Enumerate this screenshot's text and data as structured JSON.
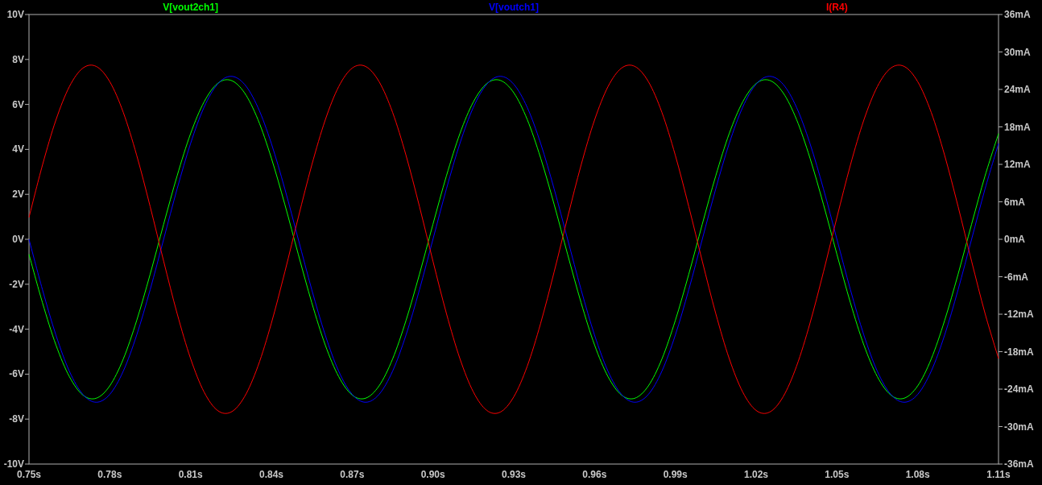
{
  "chart_data": {
    "type": "line",
    "x": [
      0.75,
      0.755,
      0.76,
      0.765,
      0.77,
      0.775,
      0.78,
      0.785,
      0.79,
      0.795,
      0.8,
      0.805,
      0.81,
      0.815,
      0.82,
      0.825,
      0.83,
      0.835,
      0.84,
      0.845,
      0.85,
      0.855,
      0.86,
      0.865,
      0.87,
      0.875,
      0.88,
      0.885,
      0.89,
      0.895,
      0.9,
      0.905,
      0.91,
      0.915,
      0.92,
      0.925,
      0.93,
      0.935,
      0.94,
      0.945,
      0.95,
      0.955,
      0.96,
      0.965,
      0.97,
      0.975,
      0.98,
      0.985,
      0.99,
      0.995,
      1.0,
      1.005,
      1.01,
      1.015,
      1.02,
      1.025,
      1.03,
      1.035,
      1.04,
      1.045,
      1.05,
      1.055,
      1.06,
      1.065,
      1.07,
      1.075,
      1.08,
      1.085,
      1.09,
      1.095,
      1.1,
      1.105,
      1.11
    ],
    "xlim": [
      0.75,
      1.11
    ],
    "ylim": [
      -10,
      10
    ],
    "xticks": [
      {
        "value": 0.75,
        "label": "0.75s"
      },
      {
        "value": 0.78,
        "label": "0.78s"
      },
      {
        "value": 0.81,
        "label": "0.81s"
      },
      {
        "value": 0.84,
        "label": "0.84s"
      },
      {
        "value": 0.87,
        "label": "0.87s"
      },
      {
        "value": 0.9,
        "label": "0.90s"
      },
      {
        "value": 0.93,
        "label": "0.93s"
      },
      {
        "value": 0.96,
        "label": "0.96s"
      },
      {
        "value": 0.99,
        "label": "0.99s"
      },
      {
        "value": 1.02,
        "label": "1.02s"
      },
      {
        "value": 1.05,
        "label": "1.05s"
      },
      {
        "value": 1.08,
        "label": "1.08s"
      },
      {
        "value": 1.11,
        "label": "1.11s"
      }
    ],
    "yticks": [
      {
        "value": 10,
        "label": "10V"
      },
      {
        "value": 8,
        "label": "8V"
      },
      {
        "value": 6,
        "label": "6V"
      },
      {
        "value": 4,
        "label": "4V"
      },
      {
        "value": 2,
        "label": "2V"
      },
      {
        "value": 0,
        "label": "0V"
      },
      {
        "value": -2,
        "label": "-2V"
      },
      {
        "value": -4,
        "label": "-4V"
      },
      {
        "value": -6,
        "label": "-6V"
      },
      {
        "value": -8,
        "label": "-8V"
      },
      {
        "value": -10,
        "label": "-10V"
      }
    ],
    "y2lim": [
      -36,
      36
    ],
    "y2ticks": [
      {
        "value": 36,
        "label": "36mA"
      },
      {
        "value": 30,
        "label": "30mA"
      },
      {
        "value": 24,
        "label": "24mA"
      },
      {
        "value": 18,
        "label": "18mA"
      },
      {
        "value": 12,
        "label": "12mA"
      },
      {
        "value": 6,
        "label": "6mA"
      },
      {
        "value": 0,
        "label": "0mA"
      },
      {
        "value": -6,
        "label": "-6mA"
      },
      {
        "value": -12,
        "label": "-12mA"
      },
      {
        "value": -18,
        "label": "-18mA"
      },
      {
        "value": -24,
        "label": "-24mA"
      },
      {
        "value": -30,
        "label": "-30mA"
      },
      {
        "value": -36,
        "label": "-36mA"
      }
    ],
    "series": [
      {
        "name": "V[vout2ch1]",
        "color": "#00ff00",
        "values": [
          -0.67,
          -2.82,
          -4.7,
          -6.11,
          -6.93,
          -7.07,
          -6.52,
          -5.33,
          -3.61,
          -1.55,
          0.67,
          2.82,
          4.7,
          6.11,
          6.93,
          7.07,
          6.52,
          5.33,
          3.61,
          1.55,
          -0.67,
          -2.82,
          -4.7,
          -6.11,
          -6.93,
          -7.07,
          -6.52,
          -5.33,
          -3.61,
          -1.55,
          0.67,
          2.82,
          4.7,
          6.11,
          6.93,
          7.07,
          6.52,
          5.33,
          3.61,
          1.55,
          -0.67,
          -2.82,
          -4.7,
          -6.11,
          -6.93,
          -7.07,
          -6.52,
          -5.33,
          -3.61,
          -1.55,
          0.67,
          2.82,
          4.7,
          6.11,
          6.93,
          7.07,
          6.52,
          5.33,
          3.61,
          1.55,
          -0.67,
          -2.82,
          -4.7,
          -6.11,
          -6.93,
          -7.07,
          -6.52,
          -5.33,
          -3.61,
          -1.55,
          0.67,
          2.82,
          4.7
        ]
      },
      {
        "name": "V[voutch1]",
        "color": "#0000ff",
        "values": [
          0,
          -2.24,
          -4.26,
          -5.87,
          -6.9,
          -7.25,
          -6.9,
          -5.87,
          -4.26,
          -2.24,
          0,
          2.24,
          4.26,
          5.87,
          6.9,
          7.25,
          6.9,
          5.87,
          4.26,
          2.24,
          0,
          -2.24,
          -4.26,
          -5.87,
          -6.9,
          -7.25,
          -6.9,
          -5.87,
          -4.26,
          -2.24,
          0,
          2.24,
          4.26,
          5.87,
          6.9,
          7.25,
          6.9,
          5.87,
          4.26,
          2.24,
          0,
          -2.24,
          -4.26,
          -5.87,
          -6.9,
          -7.25,
          -6.9,
          -5.87,
          -4.26,
          -2.24,
          0,
          2.24,
          4.26,
          5.87,
          6.9,
          7.25,
          6.9,
          5.87,
          4.26,
          2.24,
          0,
          -2.24,
          -4.26,
          -5.87,
          -6.9,
          -7.25,
          -6.9,
          -5.87,
          -4.26,
          -2.24,
          0,
          2.24,
          4.26
        ]
      },
      {
        "name": "I(R4)",
        "color": "#ff0000",
        "axis": "y2",
        "values": [
          3.5,
          11.88,
          19.1,
          24.45,
          27.41,
          27.68,
          25.24,
          20.34,
          13.44,
          5.23,
          -3.5,
          -11.88,
          -19.1,
          -24.45,
          -27.41,
          -27.68,
          -25.24,
          -20.34,
          -13.44,
          -5.23,
          3.5,
          11.88,
          19.1,
          24.45,
          27.41,
          27.68,
          25.24,
          20.34,
          13.44,
          5.23,
          -3.5,
          -11.88,
          -19.1,
          -24.45,
          -27.41,
          -27.68,
          -25.24,
          -20.34,
          -13.44,
          -5.23,
          3.5,
          11.88,
          19.1,
          24.45,
          27.41,
          27.68,
          25.24,
          20.34,
          13.44,
          5.23,
          -3.5,
          -11.88,
          -19.1,
          -24.45,
          -27.41,
          -27.68,
          -25.24,
          -20.34,
          -13.44,
          -5.23,
          3.5,
          11.88,
          19.1,
          24.45,
          27.41,
          27.68,
          25.24,
          20.34,
          13.44,
          5.23,
          -3.5,
          -11.88,
          -19.1
        ]
      }
    ]
  }
}
